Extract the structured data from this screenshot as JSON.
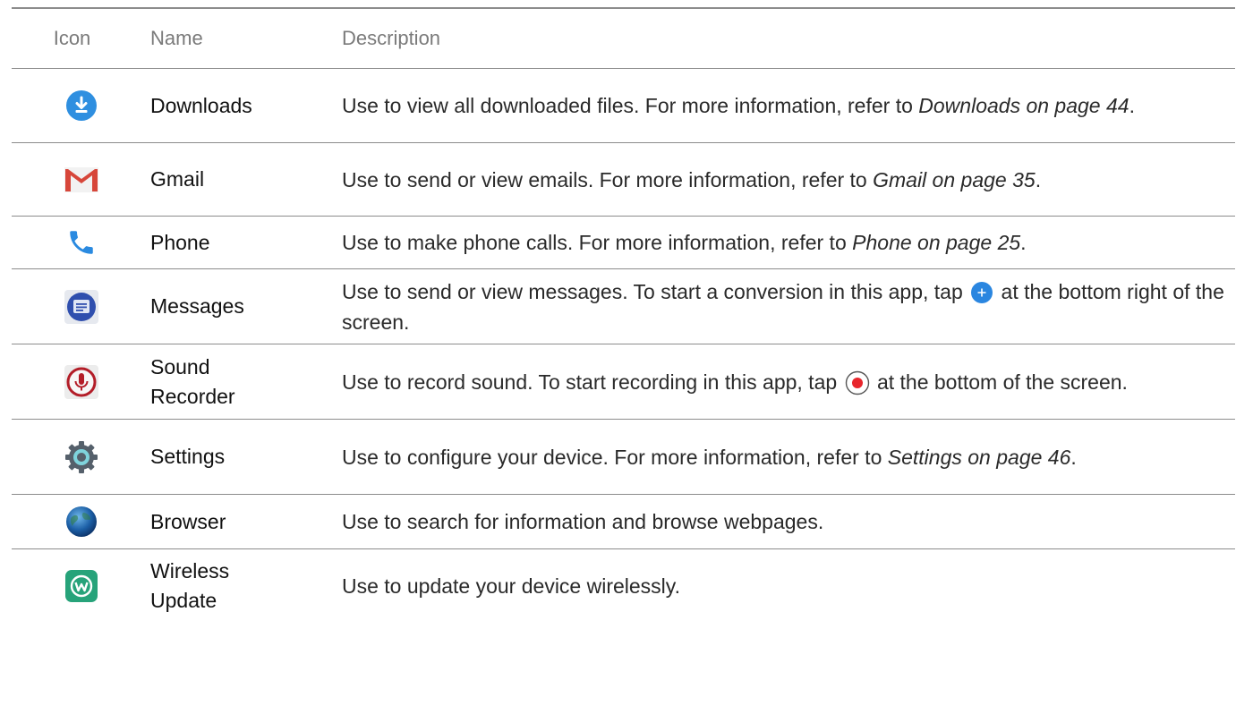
{
  "headers": {
    "icon": "Icon",
    "name": "Name",
    "description": "Description"
  },
  "rows": [
    {
      "icon": "downloads-icon",
      "name": "Downloads",
      "desc_pre": "Use to view all downloaded files. For more information, refer to ",
      "desc_ref": "Downloads on page 44",
      "desc_post": "."
    },
    {
      "icon": "gmail-icon",
      "name": "Gmail",
      "desc_pre": "Use to send or view emails. For more information, refer to ",
      "desc_ref": "Gmail on page 35",
      "desc_post": "."
    },
    {
      "icon": "phone-icon",
      "name": "Phone",
      "desc_pre": "Use to make phone calls. For more information, refer to ",
      "desc_ref": "Phone on page 25",
      "desc_post": "."
    },
    {
      "icon": "messages-icon",
      "name": "Messages",
      "desc_pre": "Use to send or view messages. To start a conversion in this app, tap",
      "desc_post": "at the bottom right of the screen."
    },
    {
      "icon": "sound-recorder-icon",
      "name_line1": "Sound",
      "name_line2": "Recorder",
      "desc_pre": "Use to record sound. To start recording in this app, tap",
      "desc_post": "at the bottom of the screen."
    },
    {
      "icon": "settings-icon",
      "name": "Settings",
      "desc_pre": "Use to configure your device. For more information, refer to ",
      "desc_ref": "Settings on page 46",
      "desc_post": "."
    },
    {
      "icon": "browser-icon",
      "name": "Browser",
      "desc": "Use to search for information and browse webpages."
    },
    {
      "icon": "wireless-update-icon",
      "name_line1": "Wireless",
      "name_line2": "Update",
      "desc": "Use to update your device wirelessly."
    }
  ],
  "colors": {
    "rule": "#8c8c8c",
    "header_text": "#7a7a7a",
    "download_blue": "#2f8fe0",
    "gmail_red": "#d7463a",
    "phone_blue": "#2a8ae0",
    "record_red": "#e8262c",
    "wireless_green": "#27a37a"
  }
}
